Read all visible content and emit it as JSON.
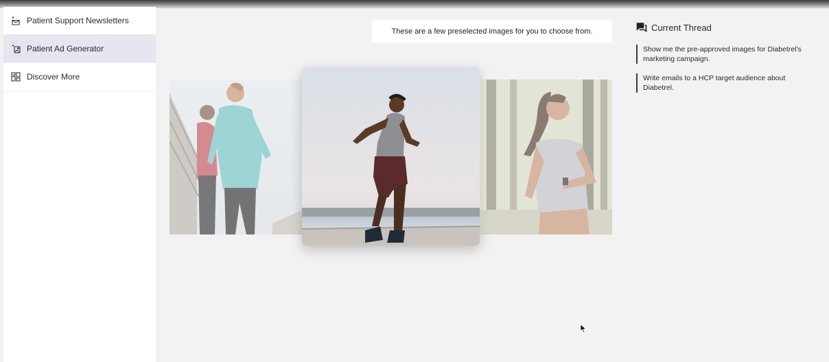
{
  "sidebar": {
    "items": [
      {
        "label": "Patient Support Newsletters",
        "icon": "sparkle-envelope-icon",
        "active": false
      },
      {
        "label": "Patient Ad Generator",
        "icon": "sparkle-image-icon",
        "active": true
      },
      {
        "label": "Discover More",
        "icon": "grid-icon",
        "active": false
      }
    ]
  },
  "main": {
    "message": "These are a few preselected images for you to choose from.",
    "images": [
      {
        "name": "two-women-running-image"
      },
      {
        "name": "man-running-on-pier-image"
      },
      {
        "name": "woman-running-in-forest-image"
      }
    ]
  },
  "thread": {
    "title": "Current Thread",
    "icon": "chat-bubbles-icon",
    "items": [
      "Show me the pre-approved images for Diabetrel's marketing campaign.",
      "Write emails to a HCP target audience about Diabetrel."
    ]
  },
  "colors": {
    "background": "#f2f2f2",
    "sidebar": "#ffffff",
    "active_item": "#e5e6ef",
    "accent_line": "#3b3b3b"
  }
}
